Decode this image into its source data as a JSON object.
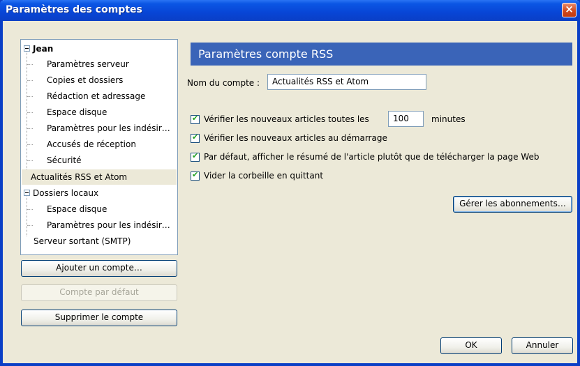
{
  "window": {
    "title": "Paramètres des comptes",
    "close_icon": "×"
  },
  "tree": [
    {
      "label": "Jean",
      "level": 0,
      "bold": true,
      "expander": true
    },
    {
      "label": "Paramètres serveur",
      "level": 1
    },
    {
      "label": "Copies et dossiers",
      "level": 1
    },
    {
      "label": "Rédaction et adressage",
      "level": 1
    },
    {
      "label": "Espace disque",
      "level": 1
    },
    {
      "label": "Paramètres pour les indésir…",
      "level": 1
    },
    {
      "label": "Accusés de réception",
      "level": 1
    },
    {
      "label": "Sécurité",
      "level": 1
    },
    {
      "label": "Actualités RSS et Atom",
      "level": 0,
      "selected": true
    },
    {
      "label": "Dossiers locaux",
      "level": 0,
      "expander": true
    },
    {
      "label": "Espace disque",
      "level": 1
    },
    {
      "label": "Paramètres pour les indésir…",
      "level": 1
    },
    {
      "label": "Serveur sortant (SMTP)",
      "level": 0
    }
  ],
  "left_buttons": {
    "add_account": "Ajouter un compte…",
    "default_account": "Compte par défaut",
    "delete_account": "Supprimer le compte"
  },
  "panel": {
    "header": "Paramètres compte RSS",
    "account_name_label": "Nom du compte :",
    "account_name_value": "Actualités RSS et Atom",
    "check_new_prefix": "Vérifier les nouveaux articles toutes les",
    "check_interval": "100",
    "check_new_suffix": "minutes",
    "check_startup": "Vérifier les nouveaux articles au démarrage",
    "show_summary": "Par défaut, afficher le résumé de l'article plutôt que de télécharger la page Web",
    "empty_trash": "Vider la corbeille en quittant",
    "manage_subscriptions": "Gérer les abonnements…"
  },
  "footer": {
    "ok": "OK",
    "cancel": "Annuler"
  },
  "colors": {
    "titlebar": "#0a3fc6",
    "header": "#3a64b8",
    "background": "#ece9d8"
  }
}
